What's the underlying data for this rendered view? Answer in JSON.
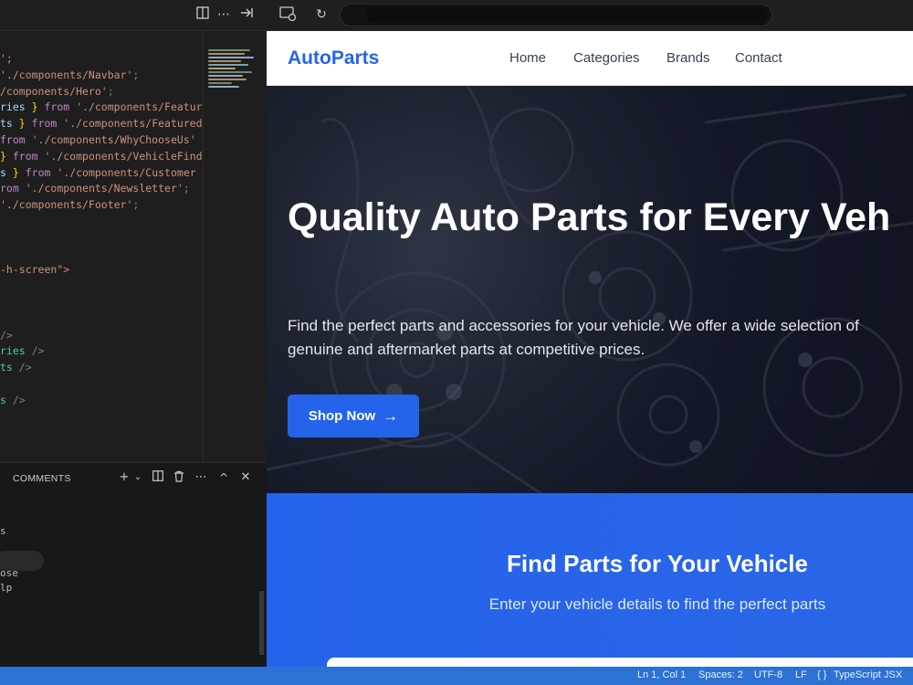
{
  "editor": {
    "code_lines": [
      {
        "parts": [
          {
            "t": "';",
            "c": "c-str"
          }
        ]
      },
      {
        "parts": [
          {
            "t": "'./components/Navbar'",
            "c": "c-str"
          },
          {
            "t": ";",
            "c": "c-pun"
          }
        ]
      },
      {
        "parts": [
          {
            "t": "/components/Hero'",
            "c": "c-str"
          },
          {
            "t": ";",
            "c": "c-pun"
          }
        ]
      },
      {
        "parts": [
          {
            "t": "ries",
            "c": "c-id"
          },
          {
            "t": " } ",
            "c": "c-br"
          },
          {
            "t": "from",
            "c": "c-kw"
          },
          {
            "t": " './components/Featur",
            "c": "c-str"
          }
        ]
      },
      {
        "parts": [
          {
            "t": "ts",
            "c": "c-id"
          },
          {
            "t": " } ",
            "c": "c-br"
          },
          {
            "t": "from",
            "c": "c-kw"
          },
          {
            "t": " './components/Featured",
            "c": "c-str"
          }
        ]
      },
      {
        "parts": [
          {
            "t": "from",
            "c": "c-kw"
          },
          {
            "t": " './components/WhyChooseUs'",
            "c": "c-str"
          }
        ]
      },
      {
        "parts": [
          {
            "t": "} ",
            "c": "c-br"
          },
          {
            "t": "from",
            "c": "c-kw"
          },
          {
            "t": " './components/VehicleFind",
            "c": "c-str"
          }
        ]
      },
      {
        "parts": [
          {
            "t": "s",
            "c": "c-id"
          },
          {
            "t": " } ",
            "c": "c-br"
          },
          {
            "t": "from",
            "c": "c-kw"
          },
          {
            "t": " './components/Customer",
            "c": "c-str"
          }
        ]
      },
      {
        "parts": [
          {
            "t": "rom",
            "c": "c-kw"
          },
          {
            "t": " './components/Newsletter'",
            "c": "c-str"
          },
          {
            "t": ";",
            "c": "c-pun"
          }
        ]
      },
      {
        "parts": [
          {
            "t": "'./components/Footer'",
            "c": "c-str"
          },
          {
            "t": ";",
            "c": "c-pun"
          }
        ]
      },
      {
        "parts": []
      },
      {
        "parts": []
      },
      {
        "parts": []
      },
      {
        "parts": [
          {
            "t": "-h-screen\">",
            "c": "c-str"
          }
        ]
      },
      {
        "parts": []
      },
      {
        "parts": []
      },
      {
        "parts": []
      },
      {
        "parts": [
          {
            "t": "/>",
            "c": "c-pun"
          }
        ]
      },
      {
        "parts": [
          {
            "t": "ries",
            "c": "c-tag"
          },
          {
            "t": " />",
            "c": "c-pun"
          }
        ]
      },
      {
        "parts": [
          {
            "t": "ts",
            "c": "c-tag"
          },
          {
            "t": " />",
            "c": "c-pun"
          }
        ]
      },
      {
        "parts": []
      },
      {
        "parts": [
          {
            "t": "s",
            "c": "c-tag"
          },
          {
            "t": " />",
            "c": "c-pun"
          }
        ]
      }
    ],
    "minimap_colors": [
      "#6b8e6b",
      "#b08f6a",
      "#8ca7c9",
      "#b08f6a",
      "#7fa0b8",
      "#b0a06a",
      "#6b8e6b",
      "#8ca7c9",
      "#b08f6a",
      "#6b8e6b",
      "#8ca7c9"
    ]
  },
  "panel": {
    "title": "COMMENTS",
    "lines": [
      "s",
      "",
      "",
      "ose",
      "lp"
    ]
  },
  "statusbar": {
    "position": "Ln 1, Col 1",
    "spaces": "Spaces: 2",
    "encoding": "UTF-8",
    "eol": "LF",
    "language_icon": "{ }",
    "language": "TypeScript JSX"
  },
  "site": {
    "brand": "AutoParts",
    "nav": [
      "Home",
      "Categories",
      "Brands",
      "Contact"
    ],
    "hero": {
      "title": "Quality Auto Parts for Every Veh",
      "subtitle_line1": "Find the perfect parts and accessories for your vehicle. We offer a wide selection of",
      "subtitle_line2": "genuine and aftermarket parts at competitive prices.",
      "cta": "Shop Now",
      "cta_icon": "→"
    },
    "finder": {
      "title": "Find Parts for Your Vehicle",
      "subtitle": "Enter your vehicle details to find the perfect parts"
    }
  },
  "colors": {
    "brand_blue": "#2563eb",
    "status_blue": "#2c71d4",
    "editor_bg": "#1e1e1e"
  }
}
